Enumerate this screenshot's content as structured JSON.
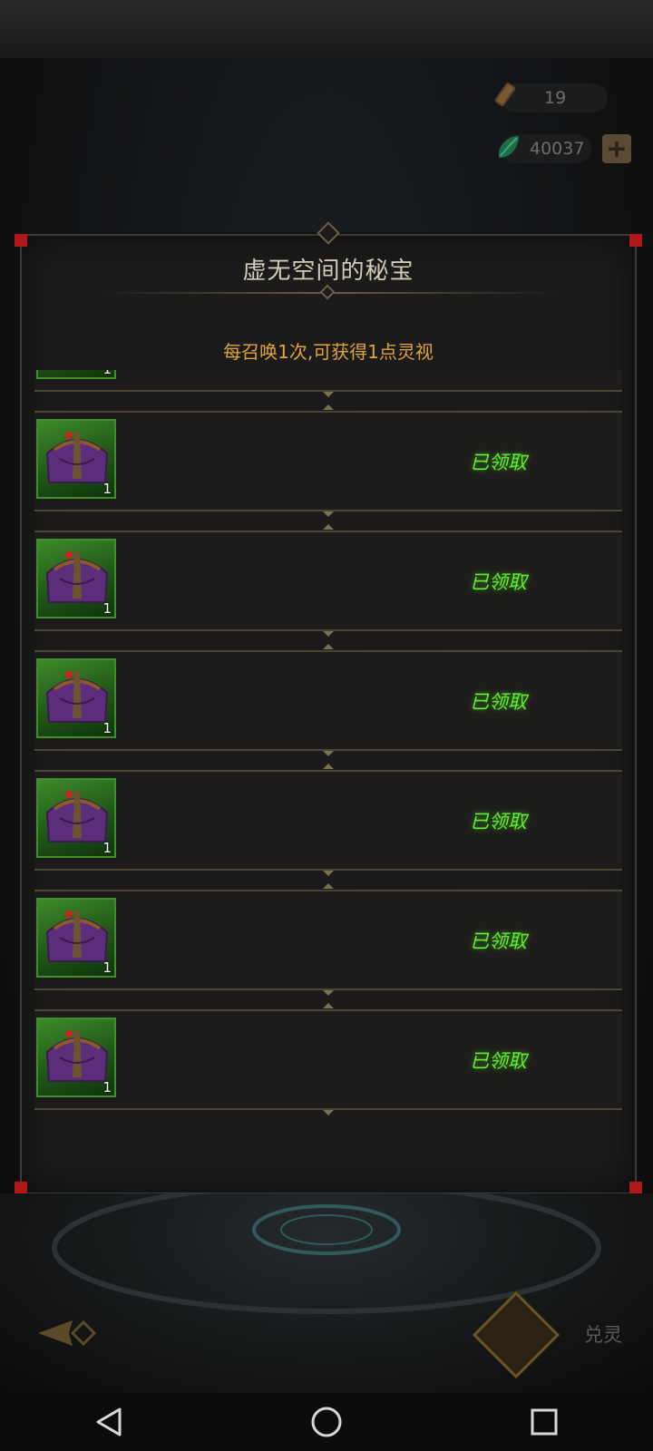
{
  "currencies": {
    "scroll": {
      "value": "19",
      "icon": "scroll-icon"
    },
    "jade": {
      "value": "40037",
      "icon": "jade-leaf-icon"
    }
  },
  "dialog": {
    "title": "虚无空间的秘宝",
    "subtitle": "每召唤1次,可获得1点灵视"
  },
  "rewards": [
    {
      "count": "1",
      "status": ""
    },
    {
      "count": "1",
      "status": "已领取"
    },
    {
      "count": "1",
      "status": "已领取"
    },
    {
      "count": "1",
      "status": "已领取"
    },
    {
      "count": "1",
      "status": "已领取"
    },
    {
      "count": "1",
      "status": "已领取"
    },
    {
      "count": "1",
      "status": "已领取"
    }
  ],
  "footer": {
    "right_label": "兑灵"
  },
  "colors": {
    "accent_gold": "#e0a437",
    "claimed_green": "#66ee33",
    "corner_red": "#b01818"
  }
}
